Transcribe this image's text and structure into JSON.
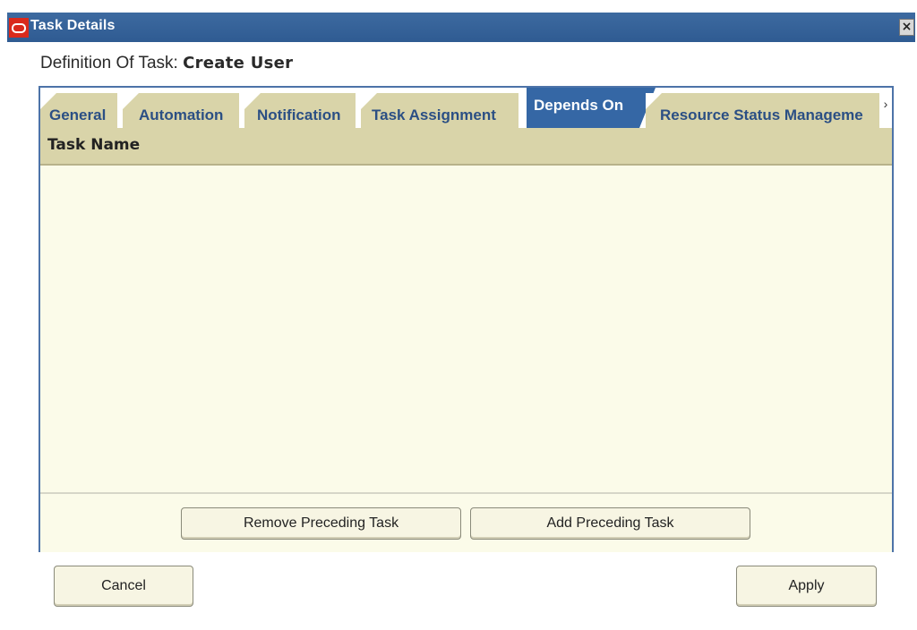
{
  "window": {
    "title": "Task Details",
    "close_symbol": "×"
  },
  "definition": {
    "label": "Definition Of Task: ",
    "task_name": "Create User"
  },
  "tabs": [
    {
      "label": "General",
      "active": false
    },
    {
      "label": "Automation",
      "active": false
    },
    {
      "label": "Notification",
      "active": false
    },
    {
      "label": "Task Assignment",
      "active": false
    },
    {
      "label": "Depends On",
      "active": true
    },
    {
      "label": "Resource Status Manageme",
      "active": false
    }
  ],
  "tab_scroll_symbol": "›",
  "table": {
    "columns": [
      "Task Name"
    ],
    "rows": []
  },
  "panel_buttons": {
    "remove_label": "Remove Preceding Task",
    "add_label": "Add Preceding Task"
  },
  "dialog_buttons": {
    "cancel_label": "Cancel",
    "apply_label": "Apply"
  },
  "colors": {
    "titlebar": "#2f5b92",
    "tab_inactive": "#d9d4a9",
    "tab_active": "#3567a5",
    "panel_bg": "#fbfbe9",
    "logo": "#d92a1c"
  },
  "icons": {
    "logo": "oracle-logo-icon",
    "close": "close-icon",
    "scroll": "chevron-right-icon"
  }
}
